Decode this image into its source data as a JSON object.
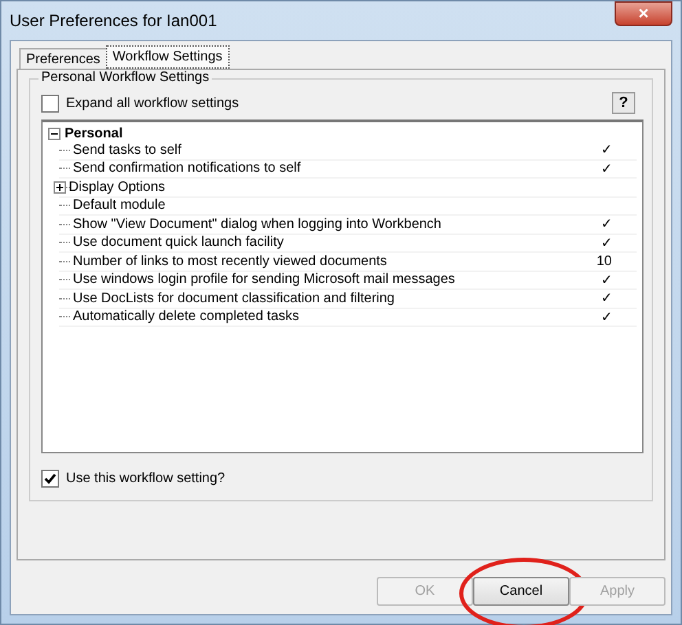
{
  "window": {
    "title": "User Preferences for Ian001",
    "close": "×"
  },
  "tabs": [
    {
      "label": "Preferences",
      "selected": false
    },
    {
      "label": "Workflow Settings",
      "selected": true
    }
  ],
  "group": {
    "title": "Personal Workflow Settings",
    "expand_all": {
      "label": "Expand all workflow settings",
      "checked": false
    },
    "help": "?"
  },
  "tree": {
    "label": "Personal",
    "expanded": true,
    "children": [
      {
        "label": "Send tasks to self",
        "value": "✓"
      },
      {
        "label": "Send confirmation notifications to self",
        "value": "✓"
      },
      {
        "label": "Display Options",
        "expanded": false
      },
      {
        "label": "Default module"
      },
      {
        "label": "Show \"View Document\" dialog when logging into Workbench",
        "value": "✓"
      },
      {
        "label": "Use document quick launch facility",
        "value": "✓"
      },
      {
        "label": "Number of links to most recently viewed documents",
        "value": "10"
      },
      {
        "label": "Use windows login profile for sending Microsoft mail messages",
        "value": "✓"
      },
      {
        "label": "Use DocLists for document classification and filtering",
        "value": "✓"
      },
      {
        "label": "Automatically delete completed tasks",
        "value": "✓"
      }
    ]
  },
  "use_setting": {
    "label": "Use this workflow setting?",
    "checked": true
  },
  "buttons": [
    {
      "label": "OK",
      "disabled": true,
      "circled": false
    },
    {
      "label": "Cancel",
      "disabled": false,
      "circled": true
    },
    {
      "label": "Apply",
      "disabled": true,
      "circled": false
    }
  ]
}
